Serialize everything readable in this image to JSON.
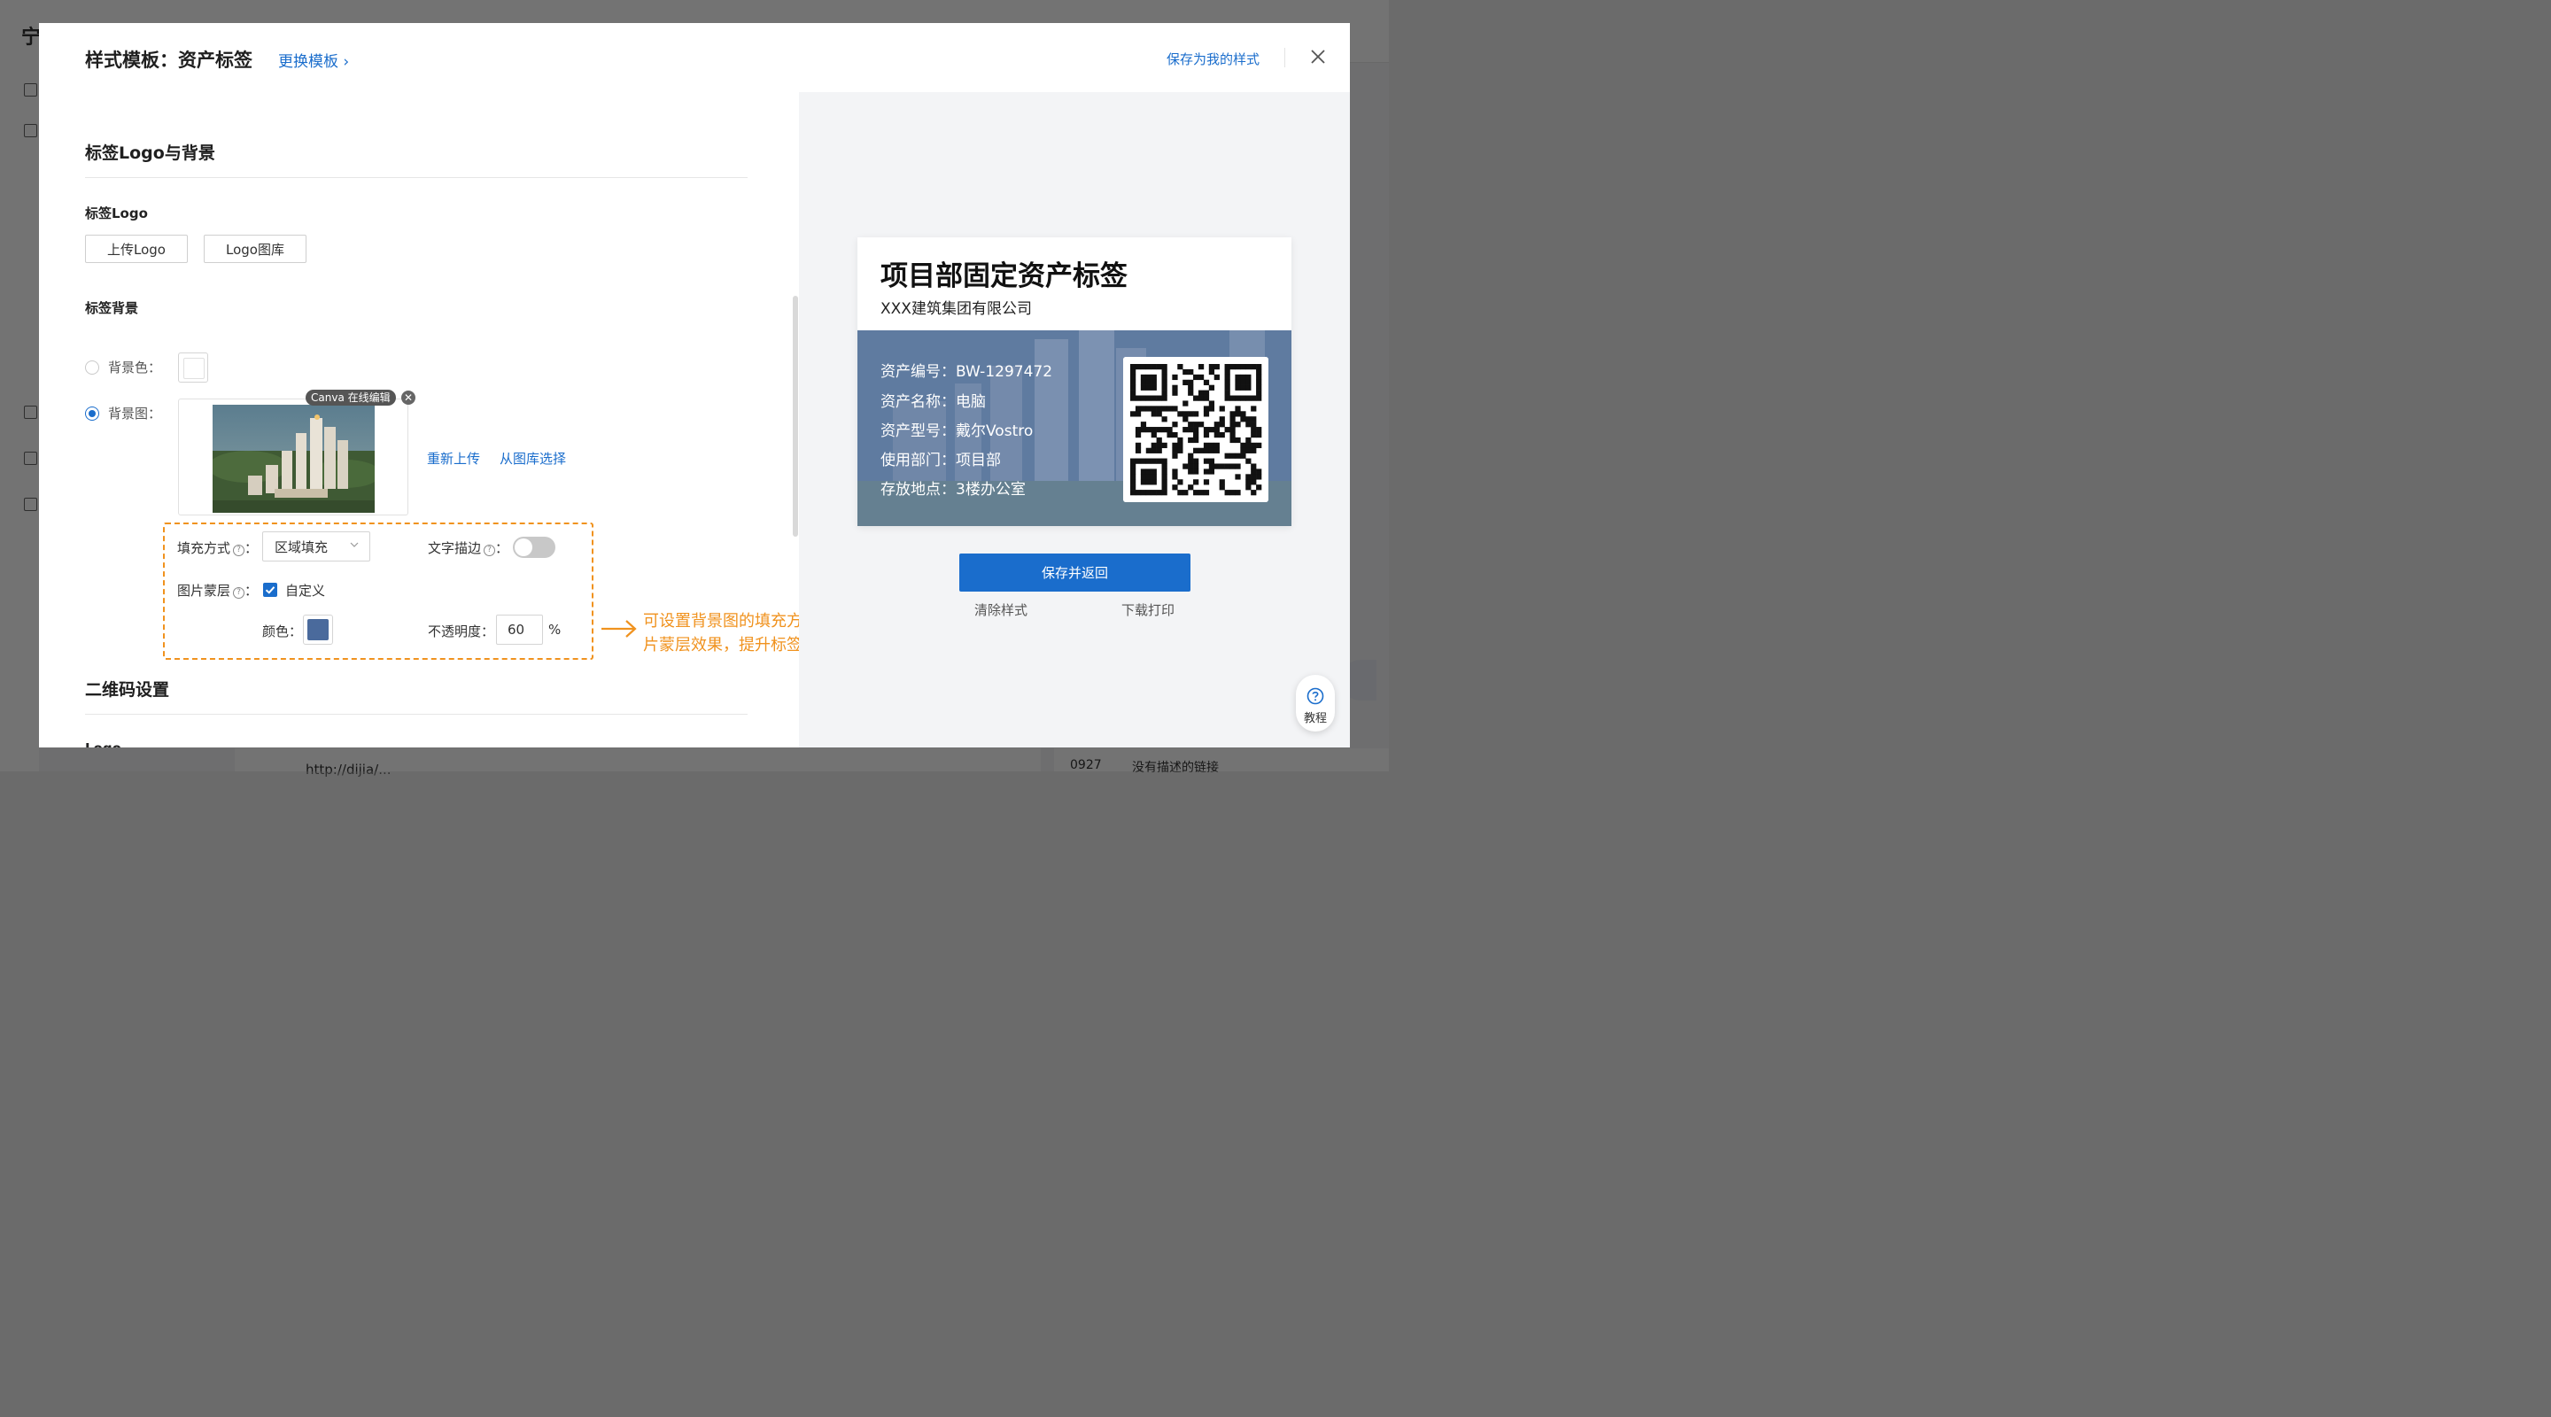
{
  "background": {
    "app_logo": "宁",
    "link_text": "http://dijia/...",
    "row_code": "0927",
    "row_desc": "没有描述的链接"
  },
  "modal": {
    "title": "样式模板：资产标签",
    "switch_template": "更换模板 ›",
    "save_as_mine": "保存为我的样式"
  },
  "logo_section": {
    "title": "标签Logo与背景",
    "logo_label": "标签Logo",
    "upload_logo": "上传Logo",
    "logo_gallery": "Logo图库",
    "bg_label": "标签背景",
    "bg_color_label": "背景色：",
    "bg_image_label": "背景图：",
    "canva_badge": "Canva 在线编辑",
    "reupload": "重新上传",
    "choose_gallery": "从图库选择",
    "selected_bg": "image"
  },
  "fill": {
    "fill_label": "填充方式",
    "fill_value": "区域填充",
    "stroke_label": "文字描边",
    "stroke_on": false,
    "mask_label": "图片蒙层",
    "mask_custom": "自定义",
    "mask_checked": true,
    "color_label": "颜色：",
    "mask_color": "#4a6a9c",
    "opacity_label": "不透明度：",
    "opacity_value": "60",
    "opacity_unit": "%"
  },
  "annotation": {
    "line1": "可设置背景图的填充方式，图",
    "line2": "片蒙层效果，提升标签美观性",
    "color": "#f0921e"
  },
  "qr_section": {
    "title": "二维码设置",
    "logo_label": "Logo"
  },
  "preview": {
    "title": "项目部固定资产标签",
    "company": "XXX建筑集团有限公司",
    "fields": [
      {
        "label": "资产编号：",
        "value": "BW-1297472"
      },
      {
        "label": "资产名称：",
        "value": "电脑"
      },
      {
        "label": "资产型号：",
        "value": "戴尔Vostro"
      },
      {
        "label": "使用部门：",
        "value": "项目部"
      },
      {
        "label": "存放地点：",
        "value": "3楼办公室"
      }
    ]
  },
  "actions": {
    "save_return": "保存并返回",
    "clear_style": "清除样式",
    "download_print": "下载打印"
  },
  "help": {
    "label": "教程"
  }
}
